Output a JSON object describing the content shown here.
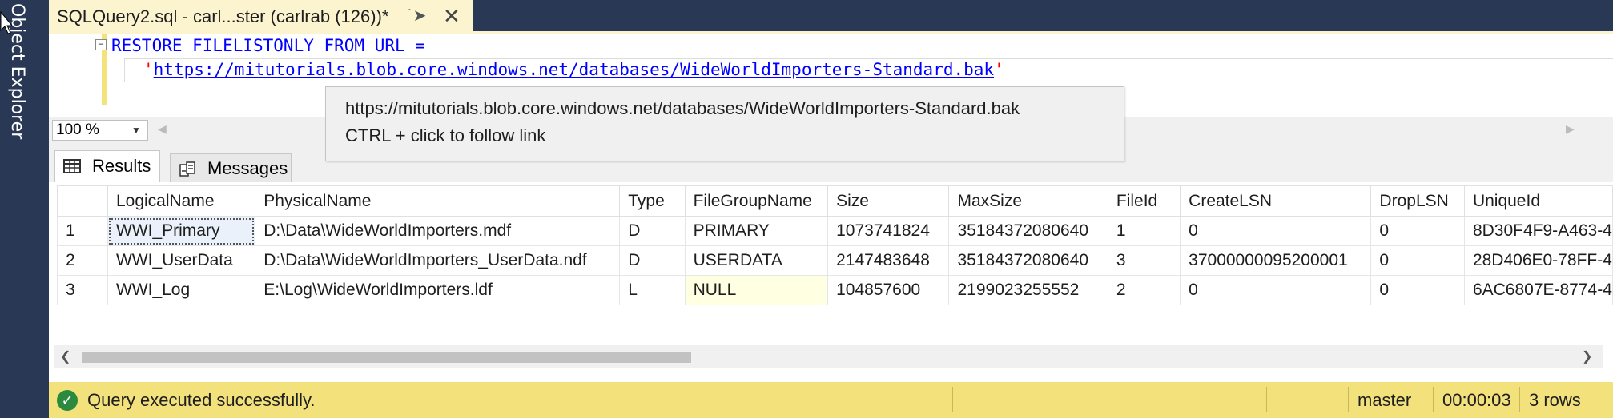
{
  "window": {
    "sidebar_label": "Object Explorer",
    "tab_title": "SQLQuery2.sql - carl...ster (carlrab (126))*",
    "tab_pin_icon": "pin-icon",
    "tab_close_icon": "close-icon"
  },
  "editor": {
    "line1": "RESTORE FILELISTONLY FROM URL =",
    "line2_quote_open": "'",
    "line2_url": "https://mitutorials.blob.core.windows.net/databases/WideWorldImporters-Standard.bak",
    "line2_quote_close": "'"
  },
  "tooltip": {
    "line1": "https://mitutorials.blob.core.windows.net/databases/WideWorldImporters-Standard.bak",
    "line2": "CTRL + click to follow link"
  },
  "zoom": {
    "value": "100 %"
  },
  "results_tabs": [
    {
      "label": "Results",
      "icon": "grid-icon"
    },
    {
      "label": "Messages",
      "icon": "messages-icon"
    }
  ],
  "grid": {
    "columns": [
      "",
      "LogicalName",
      "PhysicalName",
      "Type",
      "FileGroupName",
      "Size",
      "MaxSize",
      "FileId",
      "CreateLSN",
      "DropLSN",
      "UniqueId"
    ],
    "rows": [
      [
        "1",
        "WWI_Primary",
        "D:\\Data\\WideWorldImporters.mdf",
        "D",
        "PRIMARY",
        "1073741824",
        "35184372080640",
        "1",
        "0",
        "0",
        "8D30F4F9-A463-4"
      ],
      [
        "2",
        "WWI_UserData",
        "D:\\Data\\WideWorldImporters_UserData.ndf",
        "D",
        "USERDATA",
        "2147483648",
        "35184372080640",
        "3",
        "37000000095200001",
        "0",
        "28D406E0-78FF-4"
      ],
      [
        "3",
        "WWI_Log",
        "E:\\Log\\WideWorldImporters.ldf",
        "L",
        "NULL",
        "104857600",
        "2199023255552",
        "2",
        "0",
        "0",
        "6AC6807E-8774-4"
      ]
    ]
  },
  "status": {
    "message": "Query executed successfully.",
    "database": "master",
    "elapsed": "00:00:03",
    "rows": "3 rows",
    "accent": "#f3e27c"
  }
}
